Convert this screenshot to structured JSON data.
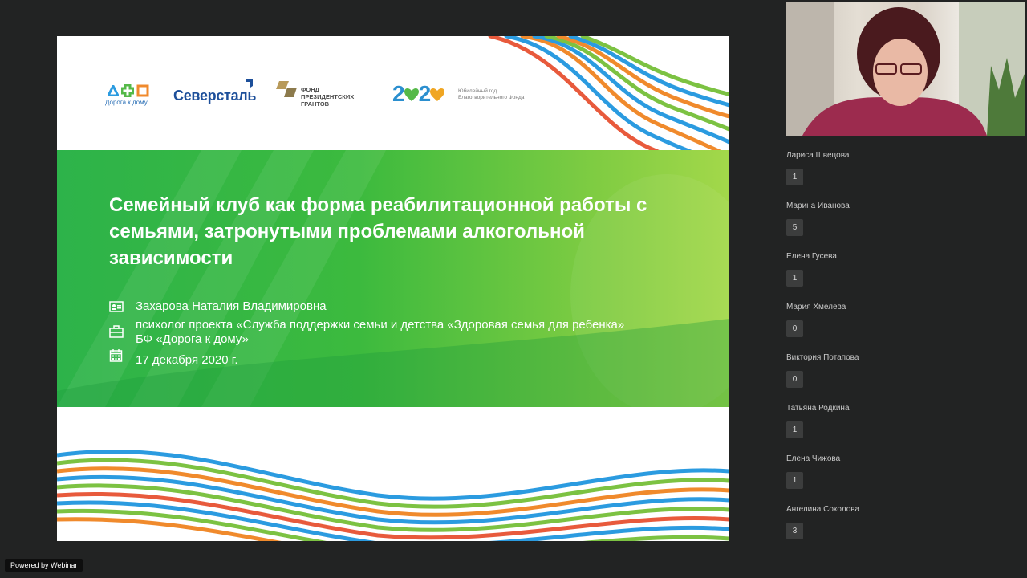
{
  "slide": {
    "logos": {
      "doroga_caption": "Дорога к дому",
      "severstal": "Северсталь",
      "fond": [
        "ФОНД",
        "ПРЕЗИДЕНТСКИХ",
        "ГРАНТОВ"
      ],
      "year_num_a": "2",
      "year_num_b": "2",
      "year_sub": [
        "Юбилейный год",
        "Благотворительного Фонда"
      ]
    },
    "title": "Семейный клуб  как форма реабилитационной работы с семьями, затронутыми проблемами алкогольной зависимости",
    "speaker_name": "Захарова Наталия Владимировна",
    "speaker_role_line1": "психолог  проекта  «Служба поддержки  семьи и детства «Здоровая семья для ребенка»",
    "speaker_role_line2": "БФ «Дорога к дому»",
    "date": "17 декабря 2020 г.",
    "icons": [
      "id-card-icon",
      "briefcase-icon",
      "calendar-icon"
    ]
  },
  "participants": [
    {
      "name": "Лариса Швецова",
      "count": "1"
    },
    {
      "name": "Марина Иванова",
      "count": "5"
    },
    {
      "name": "Елена Гусева",
      "count": "1"
    },
    {
      "name": "Мария Хмелева",
      "count": "0"
    },
    {
      "name": "Виктория Потапова",
      "count": "0"
    },
    {
      "name": "Татьяна Родкина",
      "count": "1"
    },
    {
      "name": "Елена Чижова",
      "count": "1"
    },
    {
      "name": "Ангелина Соколова",
      "count": "3"
    }
  ],
  "footer": {
    "powered_by": "Powered by Webinar"
  },
  "colors": {
    "background": "#222323",
    "slide_green": "#3cba3e",
    "stripe_blue": "#2b9be0",
    "stripe_orange": "#f08a2c",
    "stripe_green": "#7cc242"
  }
}
